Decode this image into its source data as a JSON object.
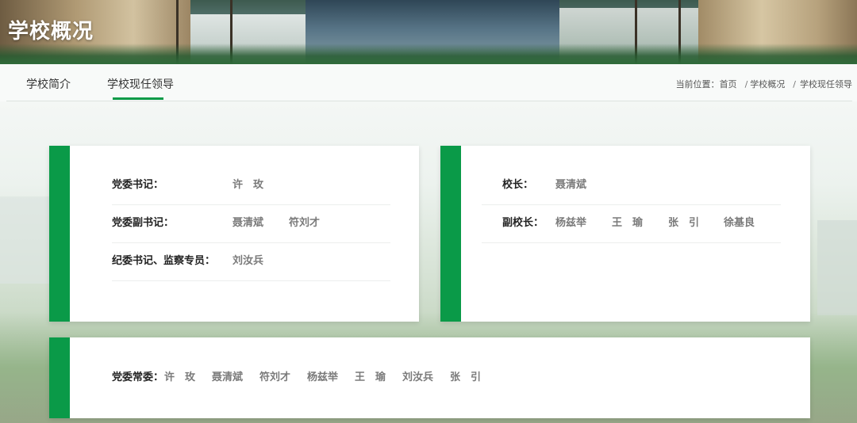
{
  "header": {
    "title": "学校概况"
  },
  "tabs": [
    {
      "label": "学校简介"
    },
    {
      "label": "学校现任领导"
    }
  ],
  "breadcrumb": {
    "prefix": "当前位置：",
    "items": [
      "首页",
      "学校概况",
      "学校现任领导"
    ],
    "separator": "/"
  },
  "party": {
    "rows": [
      {
        "label": "党委书记：",
        "names": [
          "许　玫"
        ]
      },
      {
        "label": "党委副书记：",
        "names": [
          "聂清斌",
          "符刘才"
        ]
      },
      {
        "label": "纪委书记、监察专员：",
        "names": [
          "刘汝兵"
        ]
      }
    ]
  },
  "admin": {
    "rows": [
      {
        "label": "校长：",
        "names": [
          "聂清斌"
        ]
      },
      {
        "label": "副校长：",
        "names": [
          "杨兹举",
          "王　瑜",
          "张　引",
          "徐基良"
        ]
      }
    ]
  },
  "standing_committee": {
    "label": "党委常委：",
    "names": [
      "许　玫",
      "聂清斌",
      "符刘才",
      "杨兹举",
      "王　瑜",
      "刘汝兵",
      "张　引"
    ]
  },
  "colors": {
    "accent": "#0a9a48",
    "label": "#222222",
    "value": "#7a7a7a"
  }
}
